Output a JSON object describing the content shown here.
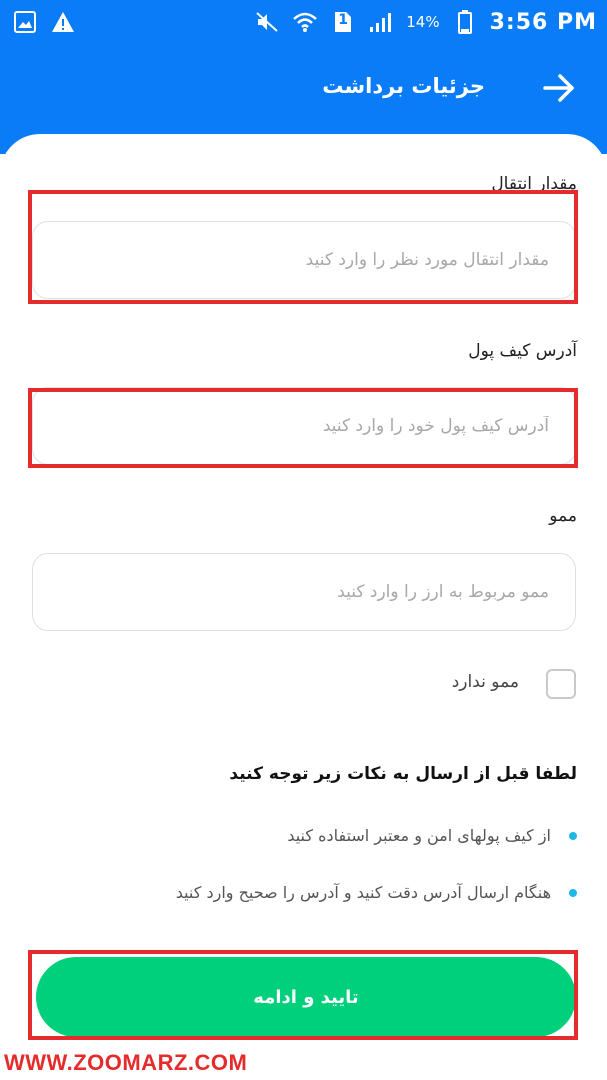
{
  "status_bar": {
    "battery_percent": "14%",
    "time": "3:56 PM",
    "sim_slot": "1",
    "icons": [
      "gallery-icon",
      "warning-icon",
      "mute-icon",
      "wifi-icon",
      "sim-icon",
      "signal-icon",
      "battery-icon"
    ]
  },
  "header": {
    "title": "جزئیات برداشت",
    "back_icon": "arrow-right-icon"
  },
  "form": {
    "amount": {
      "label": "مقدار انتقال",
      "placeholder": "مقدار انتقال مورد نظر را وارد کنید",
      "value": ""
    },
    "address": {
      "label": "آدرس کیف پول",
      "placeholder": "آدرس کیف پول خود را وارد کنید",
      "value": ""
    },
    "memo": {
      "label": "ممو",
      "placeholder": "ممو مربوط به ارز را وارد کنید",
      "value": ""
    },
    "no_memo": {
      "label": "ممو ندارد",
      "checked": false
    }
  },
  "notice": {
    "title": "لطفا قبل از ارسال به نکات زیر توجه کنید",
    "items": [
      "از کیف پولهای امن و معتبر استفاده کنید",
      "هنگام ارسال آدرس دقت کنید و آدرس را صحیح وارد کنید"
    ]
  },
  "actions": {
    "submit_label": "تایید و ادامه"
  },
  "watermark": "WWW.ZOOMARZ.COM",
  "colors": {
    "primary": "#0a7cf7",
    "accent": "#00cf7b",
    "highlight": "#e52b2b",
    "bullet": "#1fb6e8"
  }
}
